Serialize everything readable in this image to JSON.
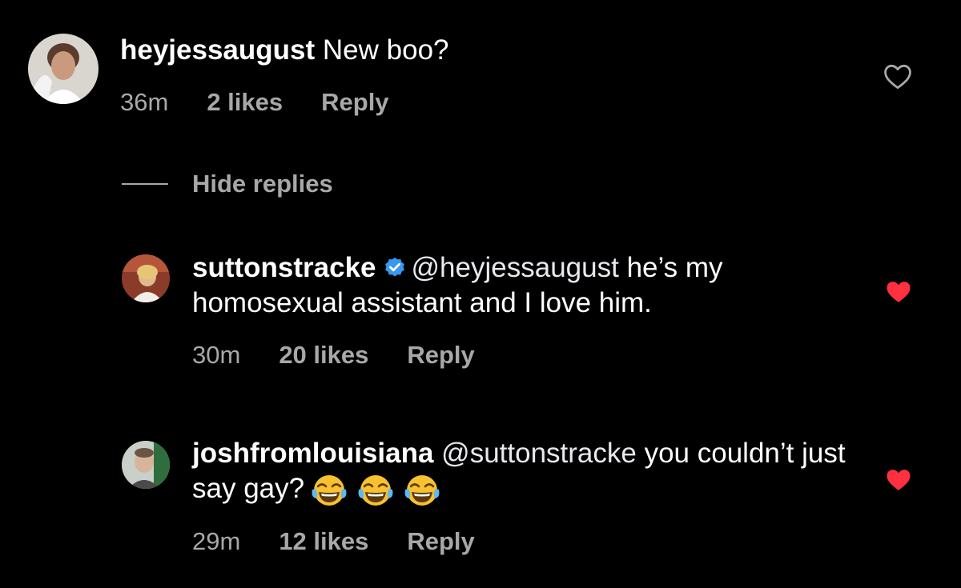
{
  "comments": [
    {
      "username": "heyjessaugust",
      "mention": "",
      "text": "New boo?",
      "time": "36m",
      "likes": "2 likes",
      "reply": "Reply",
      "liked": false
    },
    {
      "username": "suttonstracke",
      "verified": true,
      "mention": "@heyjessaugust",
      "text": "he’s my homosexual assistant and I love him.",
      "time": "30m",
      "likes": "20 likes",
      "reply": "Reply",
      "liked": true
    },
    {
      "username": "joshfromlouisiana",
      "mention": "@suttonstracke",
      "text": "you couldn’t just say gay?",
      "emoji": [
        "face-with-tears-of-joy",
        "face-with-tears-of-joy",
        "face-with-tears-of-joy"
      ],
      "time": "29m",
      "likes": "12 likes",
      "reply": "Reply",
      "liked": true
    }
  ],
  "replies_toggle": {
    "label": "Hide replies"
  },
  "colors": {
    "background": "#000000",
    "text": "#ffffff",
    "meta": "#a8a8a8",
    "heart_liked": "#ff3040",
    "verified": "#3897f0"
  }
}
